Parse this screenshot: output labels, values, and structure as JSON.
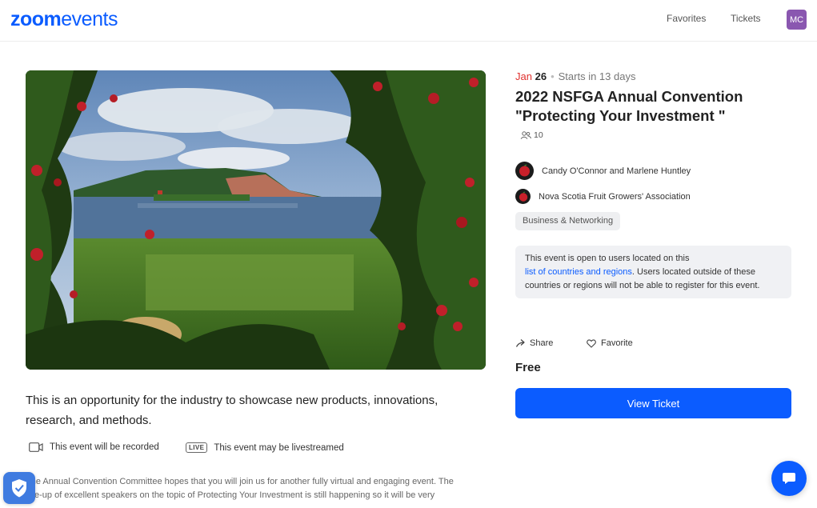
{
  "header": {
    "logo_zoom": "zoom",
    "logo_events": "events",
    "favorites_label": "Favorites",
    "tickets_label": "Tickets",
    "avatar_initials": "MC"
  },
  "event": {
    "month": "Jan",
    "day": "26",
    "starts_in": "Starts in 13 days",
    "title": "2022 NSFGA Annual Convention \"Protecting Your Investment \"",
    "attendee_count": "10",
    "organizers": [
      {
        "name": "Candy O'Connor and Marlene Huntley",
        "icon": "apple-logo-icon"
      },
      {
        "name": "Nova Scotia Fruit Growers' Association",
        "icon": "apple-logo-icon"
      }
    ],
    "category_tag": "Business & Networking",
    "notice_before_link": "This event is open to users located on this",
    "notice_link": "list of countries and regions",
    "notice_after_link": ". Users located outside of these countries or regions will not be able to register for this event.",
    "share_label": "Share",
    "favorite_label": "Favorite",
    "price": "Free",
    "view_ticket_label": "View Ticket"
  },
  "content": {
    "description": "This is an opportunity for the industry to showcase new products, innovations, research, and methods.",
    "recorded_label": "This event will be recorded",
    "live_badge": "LIVE",
    "livestream_label": "This event may be livestreamed",
    "body_line_1": "The Annual Convention Committee hopes that you will join us for another fully virtual and engaging event. The",
    "body_line_2": "line-up of excellent speakers on the topic of Protecting Your Investment is still happening so it will be very"
  },
  "colors": {
    "brand_blue": "#0b5cff",
    "date_red": "#e0312e",
    "avatar_purple": "#8a57b0"
  }
}
